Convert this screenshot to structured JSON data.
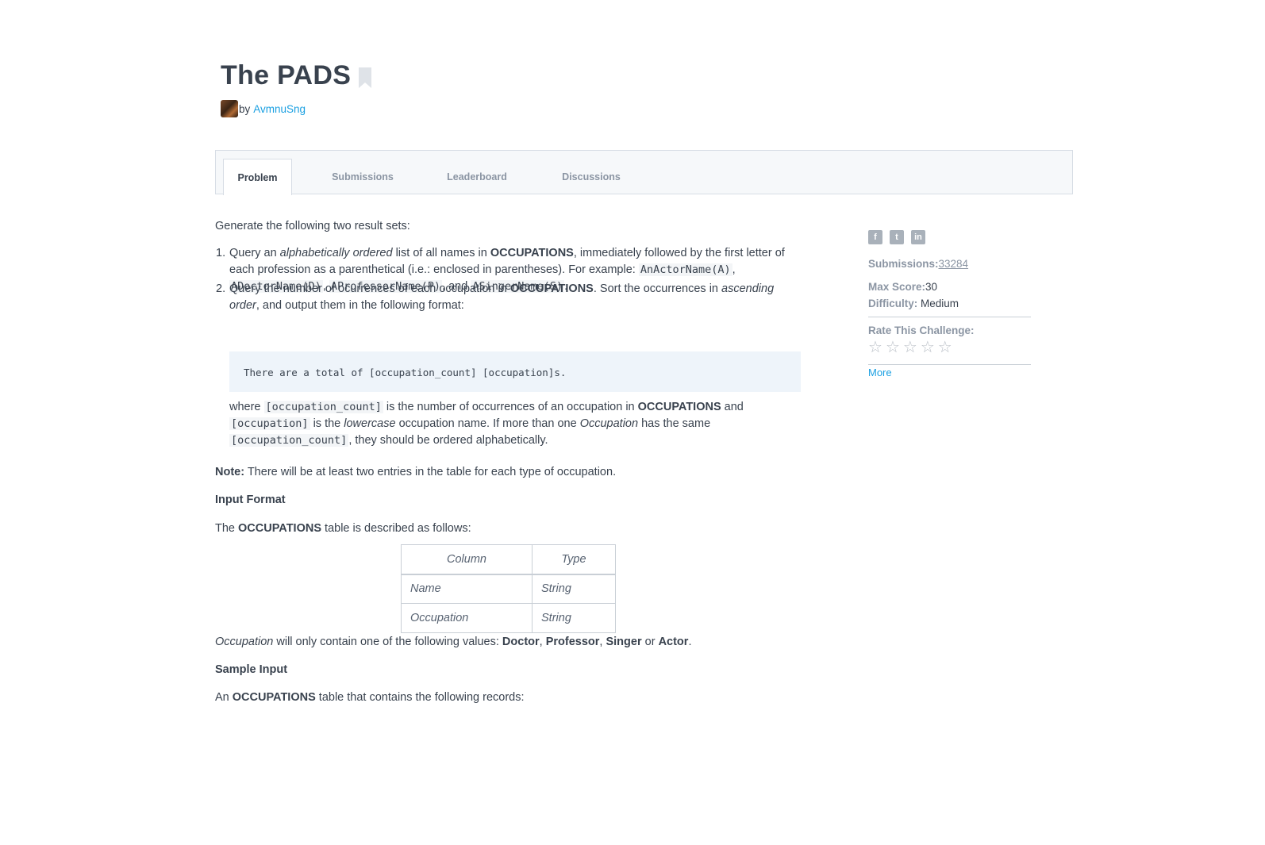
{
  "challenge": {
    "title": "The PADS",
    "by_label": "by",
    "author": "AvmnuSng"
  },
  "tabs": [
    {
      "label": "Problem"
    },
    {
      "label": "Submissions"
    },
    {
      "label": "Leaderboard"
    },
    {
      "label": "Discussions"
    }
  ],
  "problem": {
    "intro": "Generate the following two result sets:",
    "item1": {
      "num": "1.",
      "t1": "Query an ",
      "em1": "alphabetically ordered",
      "t2": " list of all names in ",
      "b1": "OCCUPATIONS",
      "t3": ", immediately followed by the first letter of each profession as a parenthetical (i.e.: enclosed in parentheses). For example: ",
      "c1": "AnActorName(A)",
      "t4": ", ",
      "c2": "ADoctorName(D)",
      "t5": ", ",
      "c3": "AProfessorName(P)",
      "t6": ", and ",
      "c4": "ASingerName(S)",
      "t7": "."
    },
    "item2": {
      "num": "2.",
      "t1": "Query the number of ocurrences of each occupation in ",
      "b1": "OCCUPATIONS",
      "t2": ". Sort the occurrences in ",
      "em1": "ascending order",
      "t3": ", and output them in the following format:"
    },
    "code_block": "There are a total of [occupation_count] [occupation]s.",
    "where": {
      "t1": "where ",
      "c1": "[occupation_count]",
      "t2": " is the number of occurrences of an occupation in ",
      "b1": "OCCUPATIONS",
      "t3": " and ",
      "c2": "[occupation]",
      "t4": " is the ",
      "em1": "lowercase",
      "t5": " occupation name. If more than one ",
      "em2": "Occupation",
      "t6": " has the same ",
      "c3": "[occupation_count]",
      "t7": ", they should be ordered alphabetically."
    },
    "note": {
      "label": "Note:",
      "text": " There will be at least two entries in the table for each type of occupation."
    },
    "input_format_heading": "Input Format",
    "table_desc": {
      "t1": "The ",
      "b1": "OCCUPATIONS",
      "t2": " table is described as follows:"
    },
    "table": {
      "headers": [
        "Column",
        "Type"
      ],
      "rows": [
        [
          "Name",
          "String"
        ],
        [
          "Occupation",
          "String"
        ]
      ]
    },
    "values": {
      "em1": "Occupation",
      "t1": " will only contain one of the following values: ",
      "b1": "Doctor",
      "t2": ", ",
      "b2": "Professor",
      "t3": ", ",
      "b3": "Singer",
      "t4": " or ",
      "b4": "Actor",
      "t5": "."
    },
    "sample_input_heading": "Sample Input",
    "sample_desc": {
      "t1": "An ",
      "b1": "OCCUPATIONS",
      "t2": " table that contains the following records:"
    }
  },
  "sidebar": {
    "social_icons": [
      "facebook-icon",
      "twitter-icon",
      "linkedin-icon"
    ],
    "submissions_label": "Submissions:",
    "submissions_value": "33284",
    "max_score_label": "Max Score:",
    "max_score_value": "30",
    "difficulty_label": "Difficulty:",
    "difficulty_value": "Medium",
    "rate_label": "Rate This Challenge:",
    "stars": 0,
    "more_label": "More"
  },
  "colors": {
    "link": "#1ba0e2",
    "text": "#39424e",
    "muted": "#8b95a3",
    "code_bg": "#eef4fa"
  }
}
